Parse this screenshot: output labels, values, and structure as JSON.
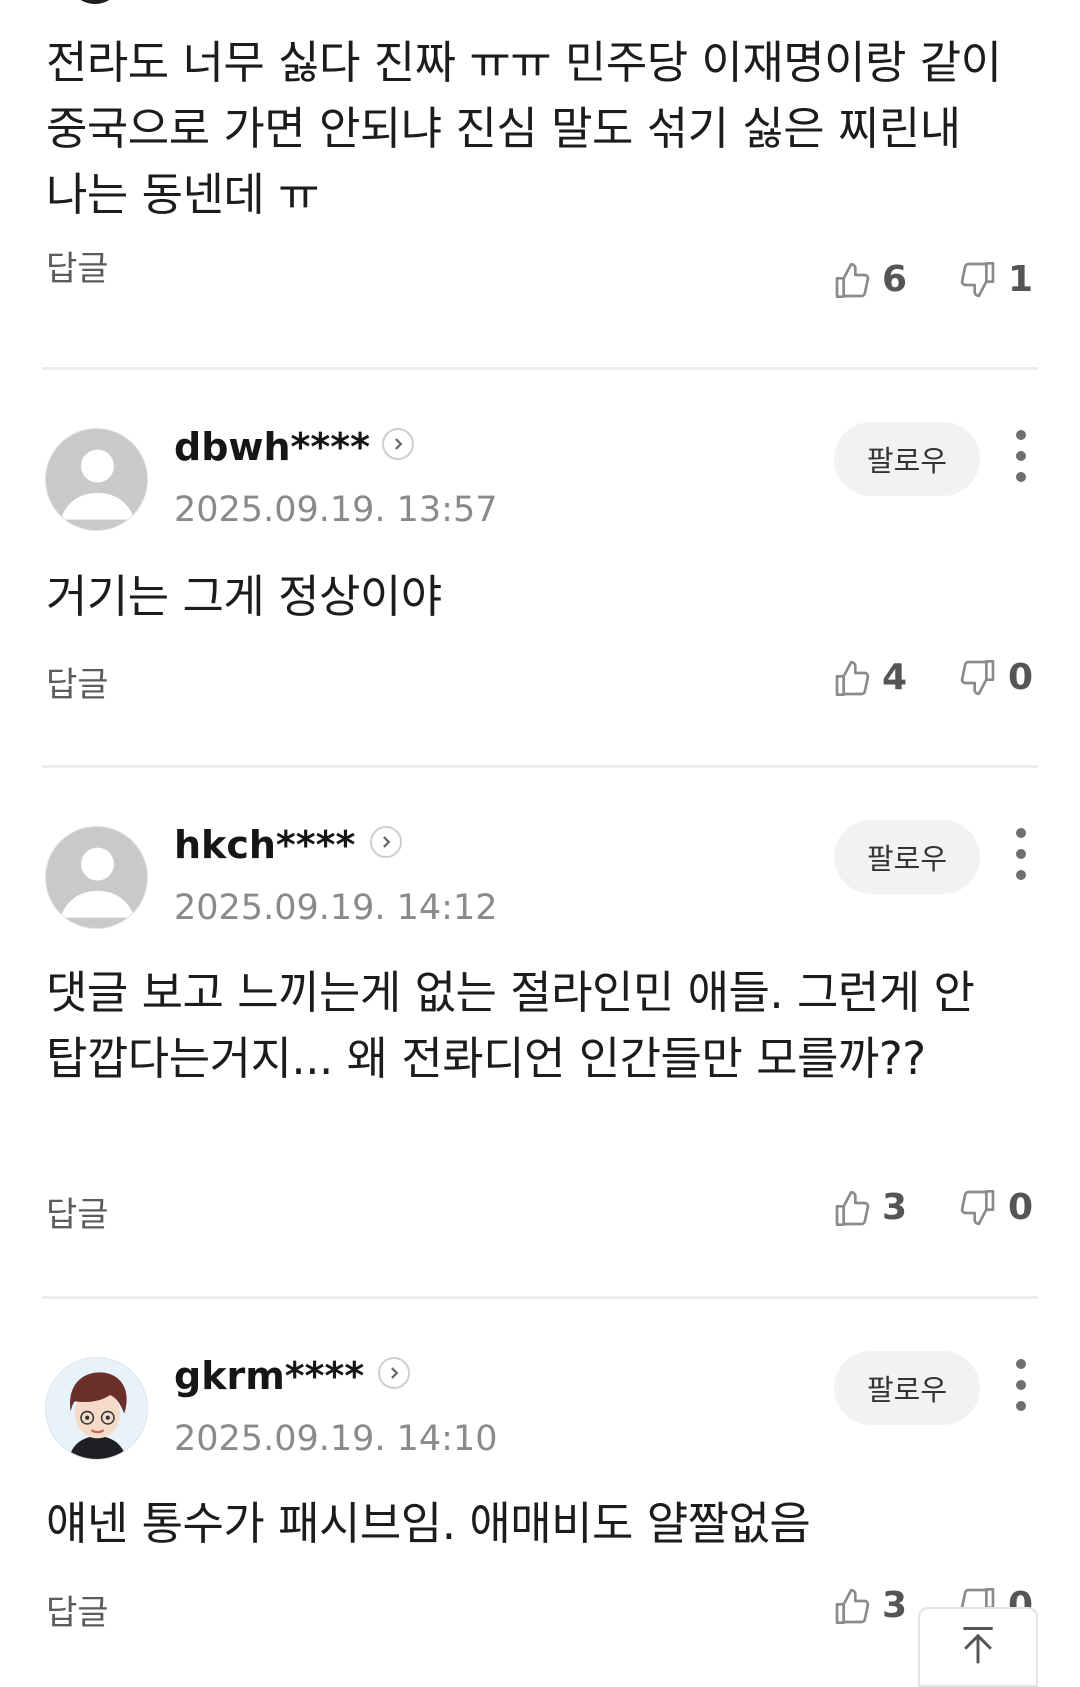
{
  "comments": [
    {
      "text": "전라도 너무 싫다 진짜 ㅠㅠ 민주당 이재명이랑 같이 중국으로 가면 안되냐 진심 말도 섞기 싫은 찌린내 나는 동넨데 ㅠ",
      "reply_label": "답글",
      "likes": "6",
      "dislikes": "1"
    },
    {
      "username": "dbwh****",
      "date": "2025.09.19. 13:57",
      "follow_label": "팔로우",
      "text": "거기는 그게 정상이야",
      "reply_label": "답글",
      "likes": "4",
      "dislikes": "0"
    },
    {
      "username": "hkch****",
      "date": "2025.09.19. 14:12",
      "follow_label": "팔로우",
      "text": "댓글 보고 느끼는게 없는 절라인민 애들. 그런게 안탑깝다는거지... 왜 전롸디언 인간들만 모를까??",
      "reply_label": "답글",
      "likes": "3",
      "dislikes": "0"
    },
    {
      "username": "gkrm****",
      "date": "2025.09.19. 14:10",
      "follow_label": "팔로우",
      "text": "얘넨 통수가 패시브임. 애매비도 얄짤없음",
      "reply_label": "답글",
      "likes": "3",
      "dislikes": "0"
    }
  ],
  "colors": {
    "text": "#1c1c1c",
    "meta": "#8a8a8a",
    "icon": "#8a8a8a",
    "divider": "#ececec",
    "follow_bg": "#f2f2f2",
    "avatar_default": "#c8c9cb"
  },
  "icons": [
    "thumbs-up-icon",
    "thumbs-down-icon",
    "chevron-right-icon",
    "more-vertical-icon",
    "scroll-top-arrow-icon"
  ]
}
